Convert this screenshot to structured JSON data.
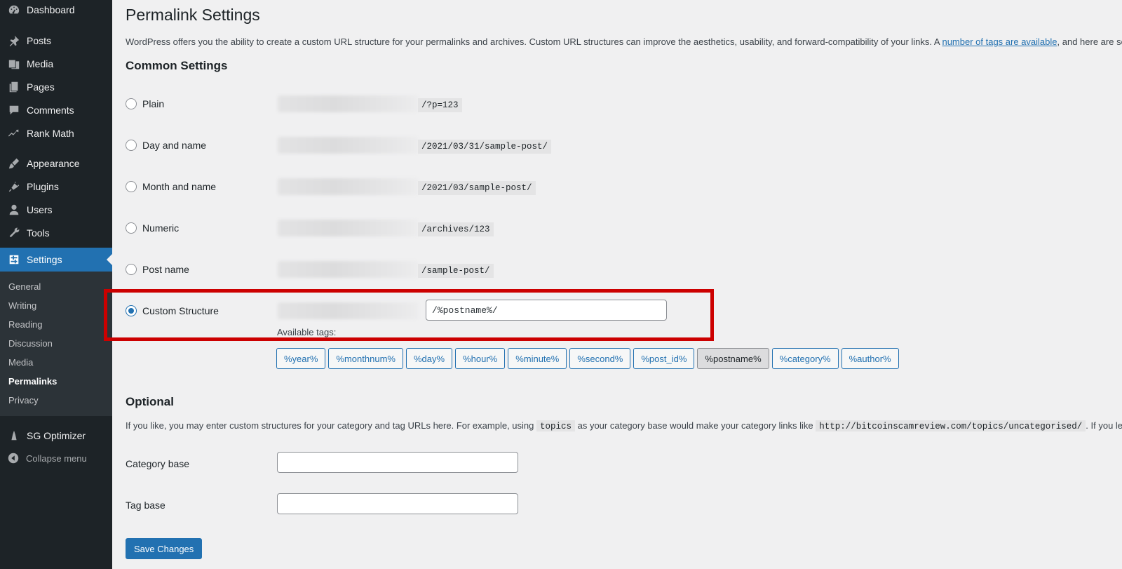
{
  "sidebar": {
    "items": [
      {
        "label": "Dashboard",
        "icon": "dashboard-icon"
      },
      {
        "label": "Posts",
        "icon": "pin-icon"
      },
      {
        "label": "Media",
        "icon": "media-icon"
      },
      {
        "label": "Pages",
        "icon": "pages-icon"
      },
      {
        "label": "Comments",
        "icon": "comment-icon"
      },
      {
        "label": "Rank Math",
        "icon": "rank-math-icon"
      },
      {
        "label": "Appearance",
        "icon": "brush-icon"
      },
      {
        "label": "Plugins",
        "icon": "plug-icon"
      },
      {
        "label": "Users",
        "icon": "user-icon"
      },
      {
        "label": "Tools",
        "icon": "wrench-icon"
      },
      {
        "label": "Settings",
        "icon": "settings-icon"
      }
    ],
    "submenu": [
      "General",
      "Writing",
      "Reading",
      "Discussion",
      "Media",
      "Permalinks",
      "Privacy"
    ],
    "sg_optimizer": "SG Optimizer",
    "collapse": "Collapse menu"
  },
  "page": {
    "title": "Permalink Settings",
    "intro_before": "WordPress offers you the ability to create a custom URL structure for your permalinks and archives. Custom URL structures can improve the aesthetics, usability, and forward-compatibility of your links. A ",
    "intro_link": "number of tags are available",
    "intro_after": ", and here are some ex",
    "common_heading": "Common Settings",
    "options": [
      {
        "label": "Plain",
        "slug": "/?p=123",
        "checked": false
      },
      {
        "label": "Day and name",
        "slug": "/2021/03/31/sample-post/",
        "checked": false
      },
      {
        "label": "Month and name",
        "slug": "/2021/03/sample-post/",
        "checked": false
      },
      {
        "label": "Numeric",
        "slug": "/archives/123",
        "checked": false
      },
      {
        "label": "Post name",
        "slug": "/sample-post/",
        "checked": false
      },
      {
        "label": "Custom Structure",
        "checked": true
      }
    ],
    "custom_value": "/%postname%/",
    "available_tags_label": "Available tags:",
    "tags": [
      "%year%",
      "%monthnum%",
      "%day%",
      "%hour%",
      "%minute%",
      "%second%",
      "%post_id%",
      "%postname%",
      "%category%",
      "%author%"
    ],
    "active_tag": "%postname%",
    "optional_heading": "Optional",
    "optional_text_1": "If you like, you may enter custom structures for your category and tag URLs here. For example, using ",
    "optional_code_1": "topics",
    "optional_text_2": " as your category base would make your category links like ",
    "optional_code_2": "http://bitcoinscamreview.com/topics/uncategorised/",
    "optional_text_3": ". If you leave these",
    "category_base_label": "Category base",
    "tag_base_label": "Tag base",
    "category_base_value": "",
    "tag_base_value": "",
    "save_label": "Save Changes"
  },
  "colors": {
    "accent": "#2271b1",
    "sidebar_bg": "#1d2327",
    "highlight_box": "#cc0000"
  }
}
